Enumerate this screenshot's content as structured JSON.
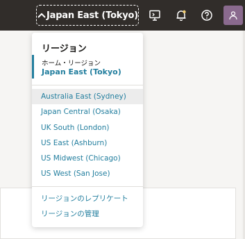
{
  "header": {
    "region_button_label": "Japan East (Tokyo)"
  },
  "region_menu": {
    "title": "リージョン",
    "home_label": "ホーム・リージョン",
    "home_value": "Japan East (Tokyo)",
    "regions": [
      "Australia East (Sydney)",
      "Japan Central (Osaka)",
      "UK South (London)",
      "US East (Ashburn)",
      "US Midwest (Chicago)",
      "US West (San Jose)"
    ],
    "actions": [
      "リージョンのレプリケート",
      "リージョンの管理"
    ]
  },
  "colors": {
    "topbar": "#312d2a",
    "accent": "#227e9e",
    "avatar": "#8a6a8e"
  }
}
